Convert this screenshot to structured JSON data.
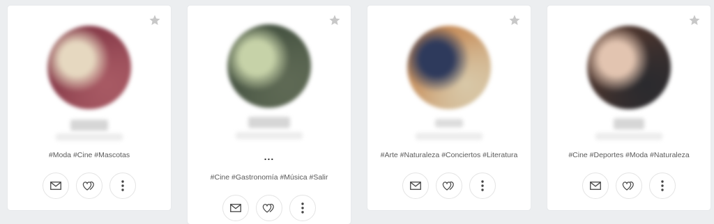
{
  "profiles": [
    {
      "tags": "#Moda #Cine #Mascotas",
      "avatar_colors": [
        "#7a2e3e",
        "#e6d8c0",
        "#a85a64"
      ]
    },
    {
      "tags": "#Cine #Gastronomía #Música #Salir",
      "ellipsis": "...",
      "avatar_colors": [
        "#3c4a3a",
        "#c6d2a8",
        "#5f6a55"
      ]
    },
    {
      "tags": "#Arte #Naturaleza #Conciertos #Literatura",
      "avatar_colors": [
        "#c27a40",
        "#2e3a5c",
        "#d8c8a8"
      ]
    },
    {
      "tags": "#Cine #Deportes #Moda #Naturaleza",
      "avatar_colors": [
        "#5a3a2e",
        "#e2c4b0",
        "#2a2a2e"
      ]
    }
  ],
  "icons": {
    "favorite": "star-icon",
    "message": "envelope-icon",
    "like": "double-heart-icon",
    "more": "vertical-dots-icon"
  },
  "colors": {
    "background": "#eceef0",
    "card": "#ffffff",
    "star": "#c8c8c8",
    "icon": "#444444"
  }
}
